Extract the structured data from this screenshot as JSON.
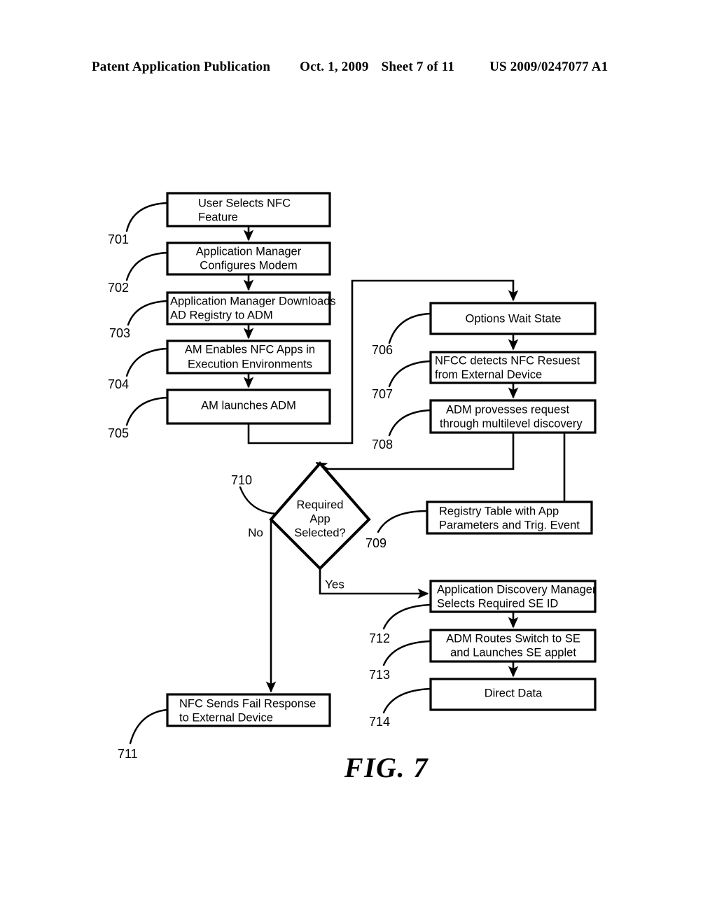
{
  "header": {
    "publication": "Patent Application Publication",
    "date": "Oct. 1, 2009",
    "sheet": "Sheet 7 of 11",
    "patent_number": "US 2009/0247077 A1"
  },
  "figure": {
    "caption": "FIG. 7",
    "boxes": [
      {
        "ref": "701",
        "line1": "User Selects NFC",
        "line2": "Feature"
      },
      {
        "ref": "702",
        "line1": "Application Manager",
        "line2": "Configures Modem"
      },
      {
        "ref": "703",
        "line1": "Application Manager Downloads",
        "line2": "AD Registry to ADM"
      },
      {
        "ref": "704",
        "line1": "AM Enables NFC Apps in",
        "line2": "Execution Environments"
      },
      {
        "ref": "705",
        "line1": "AM launches ADM",
        "line2": ""
      },
      {
        "ref": "706",
        "line1": "Options Wait State",
        "line2": ""
      },
      {
        "ref": "707",
        "line1": "NFCC detects NFC Resuest",
        "line2": "from External Device"
      },
      {
        "ref": "708",
        "line1": "ADM provesses request",
        "line2": "through multilevel discovery"
      },
      {
        "ref": "709",
        "line1": "Registry Table with App",
        "line2": "Parameters and Trig. Event"
      },
      {
        "ref": "711",
        "line1": "NFC Sends Fail Response",
        "line2": "to External Device"
      },
      {
        "ref": "712",
        "line1": "Application Discovery Manager",
        "line2": "Selects Required SE ID"
      },
      {
        "ref": "713",
        "line1": "ADM Routes Switch to SE",
        "line2": "and Launches SE applet"
      },
      {
        "ref": "714",
        "line1": "Direct Data",
        "line2": ""
      }
    ],
    "decision": {
      "ref": "710",
      "line1": "Required",
      "line2": "App",
      "line3": "Selected?",
      "branch_no": "No",
      "branch_yes": "Yes"
    }
  }
}
